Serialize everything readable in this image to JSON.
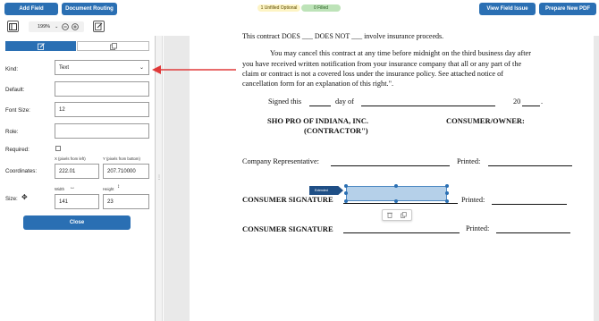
{
  "top": {
    "add_field": "Add Field",
    "document_routing": "Document Routing",
    "unfilled_optional": "1 Unfilled Optional",
    "filled": "0 Filled",
    "view_field_issue": "View Field Issue",
    "prepare_pdf": "Prepare New PDF"
  },
  "toolbar": {
    "zoom": "199%"
  },
  "sidebar": {
    "kind_label": "Kind:",
    "kind_value": "Text",
    "default_label": "Default:",
    "default_value": "",
    "font_size_label": "Font Size:",
    "font_size_value": "12",
    "role_label": "Role:",
    "role_value": "",
    "required_label": "Required:",
    "coordinates_label": "Coordinates:",
    "x_caption": "X (pixels from left)",
    "x_value": "222.01",
    "y_caption": "Y (pixels from bottom)",
    "y_value": "207.710000",
    "size_label": "Size:",
    "width_caption": "Width",
    "width_value": "141",
    "height_caption": "Height",
    "height_value": "23",
    "close": "Close"
  },
  "doc": {
    "top_cut": "This contract DOES ___ DOES NOT ___ involve insurance proceeds.",
    "p1": "You may cancel this contract at any time before midnight on the third business day after",
    "p2": "you have received written notification from your insurance company that all or any part of the",
    "p3": "claim or contract is not a covered loss under the insurance policy. See attached notice of",
    "p4": "cancellation form for an explanation of this right.\".",
    "signed_this": "Signed this",
    "day_of": "day of",
    "year": "20",
    "company": "SHO PRO OF INDIANA, INC.",
    "contractor": "(CONTRACTOR\")",
    "consumer_owner": "CONSUMER/OWNER:",
    "company_rep": "Company Representative:",
    "printed": "Printed:",
    "consumer_sig": "CONSUMER SIGNATURE",
    "field_tag": "Extended"
  },
  "colors": {
    "accent": "#2a6fb3",
    "arrow": "#e03a3a",
    "selection": "#a9cbe8"
  }
}
